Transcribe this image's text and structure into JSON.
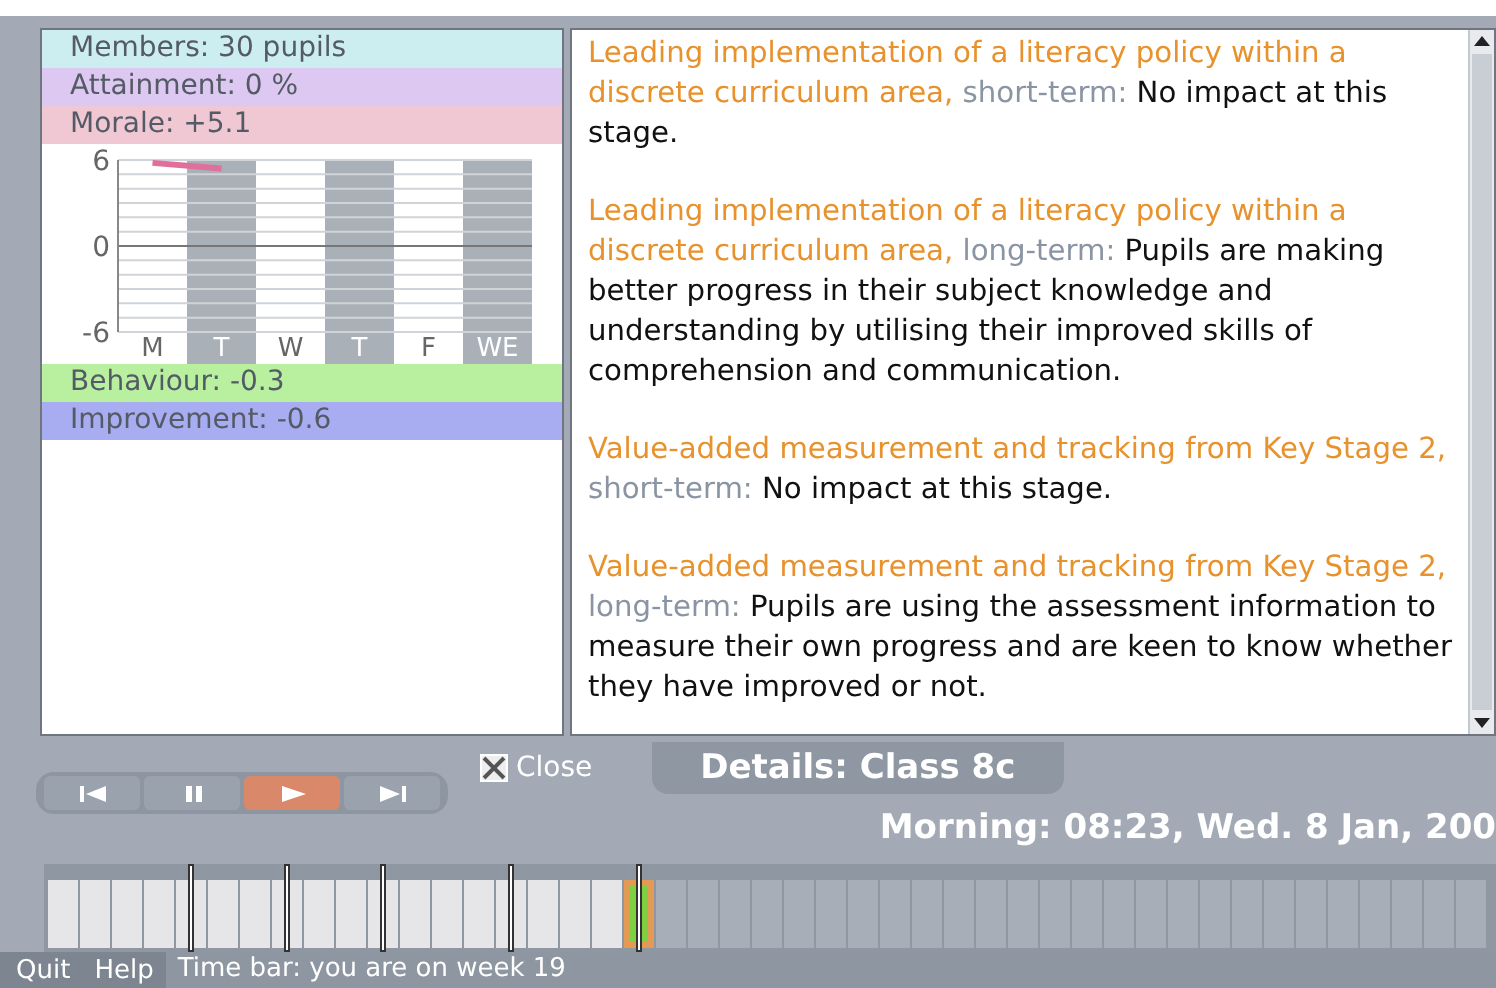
{
  "stats_top": [
    {
      "label": "Members: 30 pupils",
      "color": "#cdeef0"
    },
    {
      "label": "Attainment: 0 %",
      "color": "#dcc8f0"
    },
    {
      "label": "Morale: +5.1",
      "color": "#f0c8d4"
    }
  ],
  "morale_chart": {
    "chart_data": {
      "type": "line",
      "categories": [
        "M",
        "T",
        "W",
        "T",
        "F",
        "WE"
      ],
      "yticks": [
        -6,
        0,
        6
      ],
      "ylim": [
        -6,
        6
      ],
      "series": [
        {
          "color": "#e0709a",
          "values": [
            5.8,
            5.4,
            null,
            null,
            null,
            null
          ]
        }
      ]
    }
  },
  "stats_bottom": [
    {
      "label": "Behaviour: -0.3",
      "color": "#b8f0a0"
    },
    {
      "label": "Improvement: -0.6",
      "color": "#a8acf0"
    }
  ],
  "impacts": [
    {
      "topic": "Leading implementation of a literacy policy within a discrete curriculum area,",
      "term": "short-term:",
      "text": "No impact at this stage."
    },
    {
      "topic": "Leading implementation of a literacy policy within a discrete curriculum area,",
      "term": "long-term:",
      "text": "Pupils are making better progress in their subject knowledge and understanding by utilising their improved skills of  comprehension and communication."
    },
    {
      "topic": "Value-added measurement and tracking from Key Stage 2,",
      "term": "short-term:",
      "text": "No impact at this stage."
    },
    {
      "topic": "Value-added measurement and tracking from Key Stage 2,",
      "term": "long-term:",
      "text": "Pupils are using the assessment information to measure their own progress and are keen to know whether they have improved or not."
    }
  ],
  "playback": [
    {
      "kind": "first",
      "selected": false
    },
    {
      "kind": "pause",
      "selected": false
    },
    {
      "kind": "play",
      "selected": true
    },
    {
      "kind": "last",
      "selected": false
    }
  ],
  "close_checkbox": {
    "label": "Close",
    "checked": true
  },
  "details_title": "Details: Class 8c",
  "date": "Morning: 08:23, Wed. 8 Jan, 200",
  "timeline": {
    "level": 0.42
  },
  "footer": {
    "menu": [
      "Quit",
      "Help"
    ],
    "status": "Time bar: you are on week 19"
  }
}
